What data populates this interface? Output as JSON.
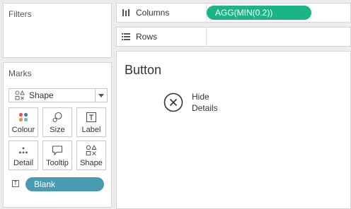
{
  "filters": {
    "title": "Filters"
  },
  "marks": {
    "title": "Marks",
    "mark_type": {
      "label": "Shape",
      "icon": "shape-icon"
    },
    "buttons": [
      {
        "label": "Colour",
        "icon": "colour-dots-icon"
      },
      {
        "label": "Size",
        "icon": "size-circles-icon"
      },
      {
        "label": "Label",
        "icon": "text-label-icon"
      },
      {
        "label": "Detail",
        "icon": "detail-dots-icon"
      },
      {
        "label": "Tooltip",
        "icon": "tooltip-bubble-icon"
      },
      {
        "label": "Shape",
        "icon": "shape-icon"
      }
    ],
    "fields": [
      {
        "icon": "T",
        "pill": "Blank",
        "color": "#4a9ab2"
      }
    ]
  },
  "shelves": {
    "columns": {
      "label": "Columns",
      "icon": "columns-icon",
      "pill": "AGG(MIN(0.2))",
      "pill_color": "#1bb486"
    },
    "rows": {
      "label": "Rows",
      "icon": "rows-icon"
    }
  },
  "view": {
    "title": "Button",
    "mark_icon": "x-circle-icon",
    "mark_text_line1": "Hide",
    "mark_text_line2": "Details"
  }
}
